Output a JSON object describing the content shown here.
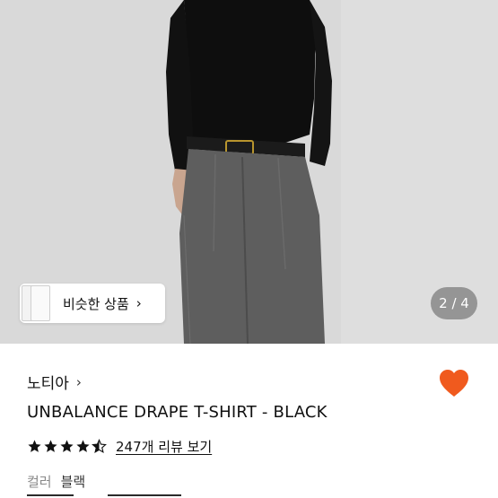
{
  "gallery": {
    "pager": "2 / 4",
    "similar_label": "비슷한 상품",
    "similar_chevron": "›"
  },
  "product": {
    "brand": "노티아",
    "brand_chevron": "›",
    "title": "UNBALANCE DRAPE T-SHIRT - BLACK",
    "rating": 4.5,
    "review_link": "247개 리뷰 보기",
    "option_label": "컬러",
    "option_value": "블랙",
    "favorited": true
  },
  "colors": {
    "heart": "#f05a1e",
    "star": "#111111",
    "accent_text": "#111111"
  }
}
